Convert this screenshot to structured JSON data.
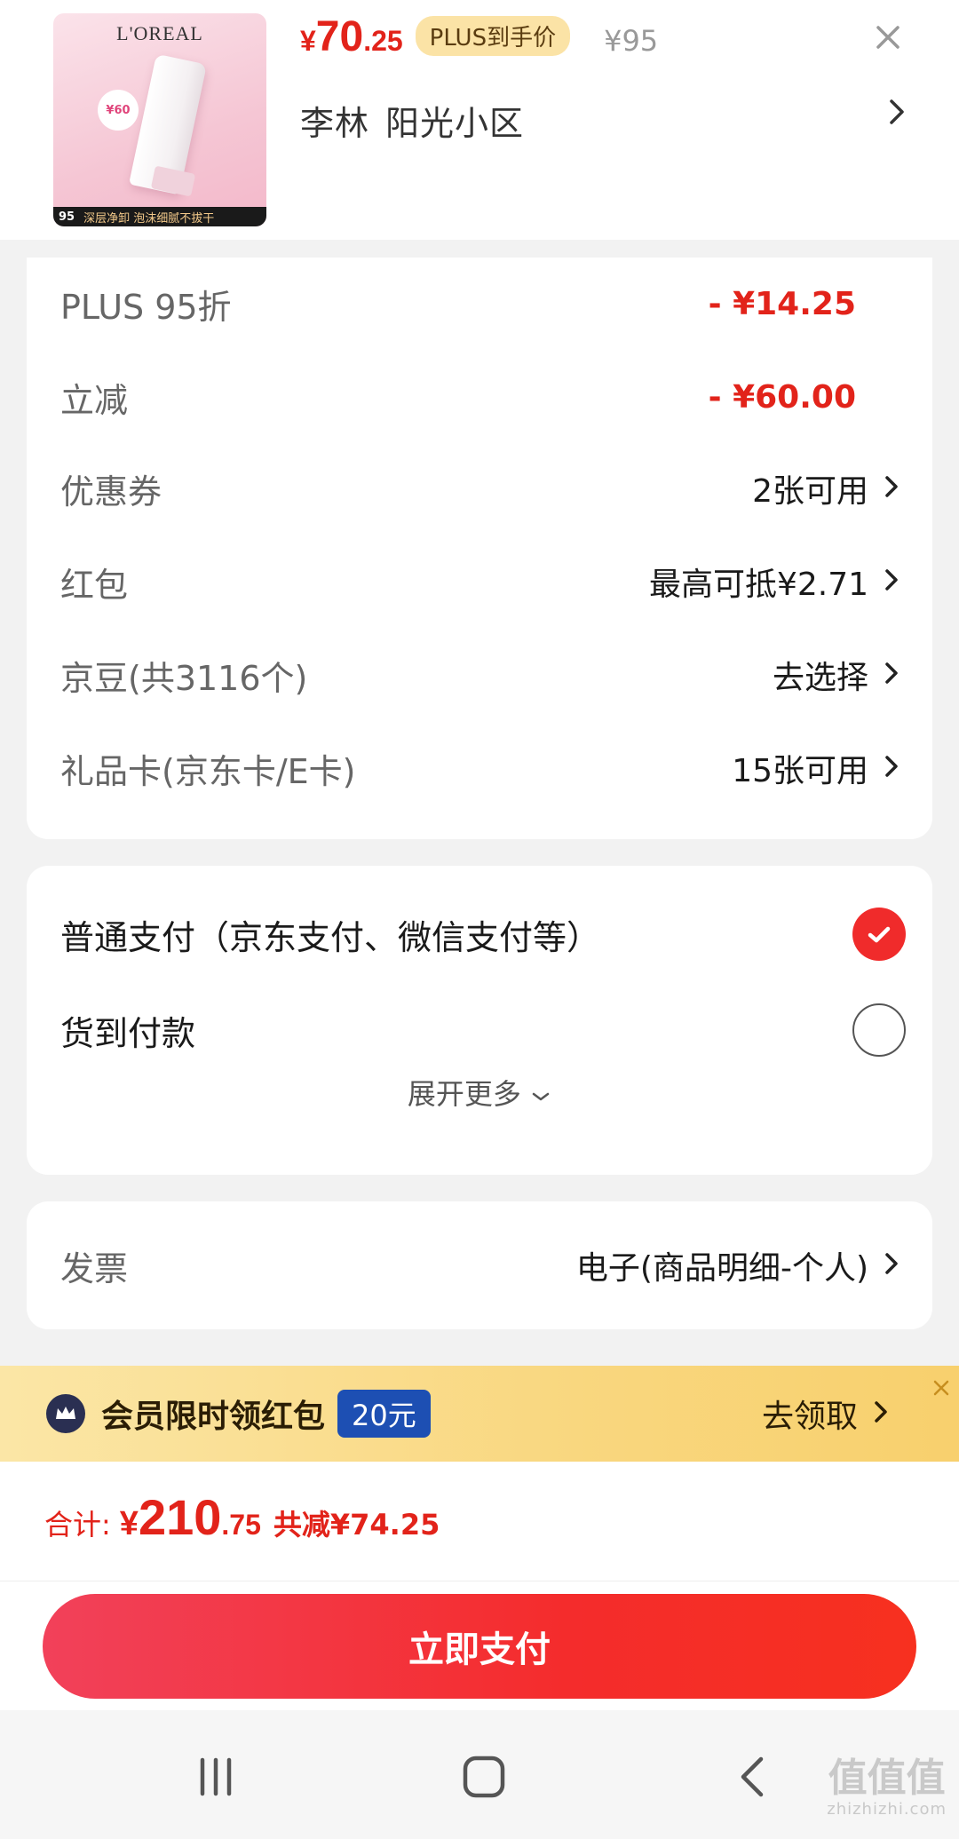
{
  "product": {
    "brand": "L'OREAL",
    "price_currency": "¥",
    "price_int": "70",
    "price_dec": ".25",
    "plus_tag": "PLUS到手价",
    "old_price": "¥95",
    "thumb_badge": "¥60",
    "thumb_strip_price": "95",
    "thumb_strip_text": "深层净卸 泡沫细腻不拔干"
  },
  "address": {
    "name": "李林",
    "place": "阳光小区"
  },
  "discounts": [
    {
      "label": "PLUS 95折",
      "value": "- ¥14.25",
      "type": "amount"
    },
    {
      "label": "立减",
      "value": "- ¥60.00",
      "type": "amount"
    },
    {
      "label": "优惠券",
      "value": "2张可用",
      "type": "link"
    },
    {
      "label": "红包",
      "value": "最高可抵¥2.71",
      "type": "link"
    },
    {
      "label": "京豆(共3116个)",
      "value": "去选择",
      "type": "link"
    },
    {
      "label": "礼品卡(京东卡/E卡)",
      "value": "15张可用",
      "type": "link"
    }
  ],
  "payment": {
    "options": [
      {
        "label": "普通支付（京东支付、微信支付等）",
        "selected": true
      },
      {
        "label": "货到付款",
        "selected": false
      }
    ],
    "expand_label": "展开更多"
  },
  "invoice": {
    "label": "发票",
    "value": "电子(商品明细-个人)"
  },
  "promo": {
    "title": "会员限时领红包",
    "badge": "20元",
    "action": "去领取"
  },
  "total": {
    "label": "合计:",
    "currency": "¥",
    "int": "210",
    "dec": ".75",
    "saved": "共减¥74.25"
  },
  "pay_button": "立即支付",
  "watermark": {
    "main": "值值值",
    "sub": "zhizhizhi.com"
  },
  "colors": {
    "accent_red": "#e2231a",
    "pay_button": "#f42c2c",
    "promo_bg": "#f9d77f",
    "plus_tag_bg": "#fbe3a6"
  }
}
